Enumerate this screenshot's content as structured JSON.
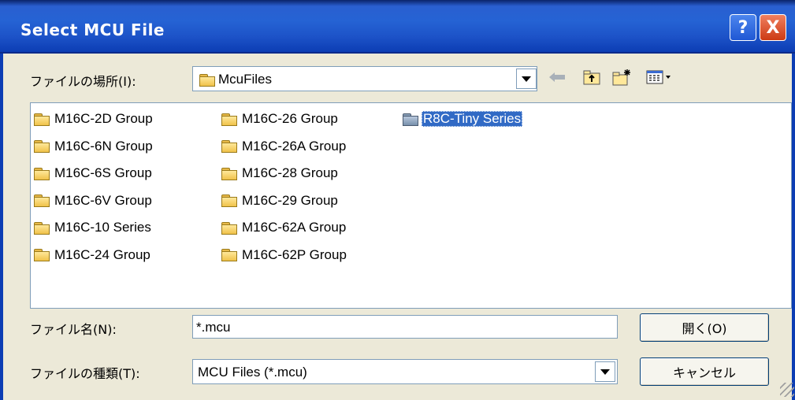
{
  "window": {
    "title": "Select MCU File",
    "help_label": "?",
    "close_label": "X"
  },
  "look_in": {
    "label": "ファイルの場所(I):",
    "value": "McuFiles"
  },
  "toolbar": {
    "back_icon": "arrow-left-icon",
    "up_icon": "folder-up-icon",
    "new_folder_icon": "new-folder-icon",
    "view_menu_icon": "view-menu-icon"
  },
  "files": [
    {
      "name": "M16C-2D Group",
      "selected": false
    },
    {
      "name": "M16C-6N Group",
      "selected": false
    },
    {
      "name": "M16C-6S Group",
      "selected": false
    },
    {
      "name": "M16C-6V Group",
      "selected": false
    },
    {
      "name": "M16C-10 Series",
      "selected": false
    },
    {
      "name": "M16C-24 Group",
      "selected": false
    },
    {
      "name": "M16C-26 Group",
      "selected": false
    },
    {
      "name": "M16C-26A Group",
      "selected": false
    },
    {
      "name": "M16C-28 Group",
      "selected": false
    },
    {
      "name": "M16C-29 Group",
      "selected": false
    },
    {
      "name": "M16C-62A Group",
      "selected": false
    },
    {
      "name": "M16C-62P Group",
      "selected": false
    },
    {
      "name": "R8C-Tiny Series",
      "selected": true
    }
  ],
  "filename": {
    "label": "ファイル名(N):",
    "value": "*.mcu"
  },
  "filetype": {
    "label": "ファイルの種類(T):",
    "value": "MCU Files (*.mcu)"
  },
  "buttons": {
    "open": "開く(O)",
    "cancel": "キャンセル"
  },
  "colors": {
    "title_bar": "#2563d4",
    "selection": "#316ac5",
    "dialog_bg": "#ece9d8"
  }
}
